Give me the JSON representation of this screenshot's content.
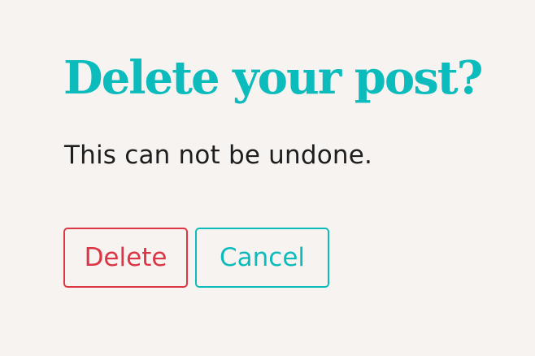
{
  "dialog": {
    "title": "Delete your post?",
    "message": "This can not be undone.",
    "delete_label": "Delete",
    "cancel_label": "Cancel"
  },
  "colors": {
    "background": "#f6f3f1",
    "accent": "#0cbcbc",
    "danger": "#dc3545",
    "text": "#1e1e1e"
  }
}
